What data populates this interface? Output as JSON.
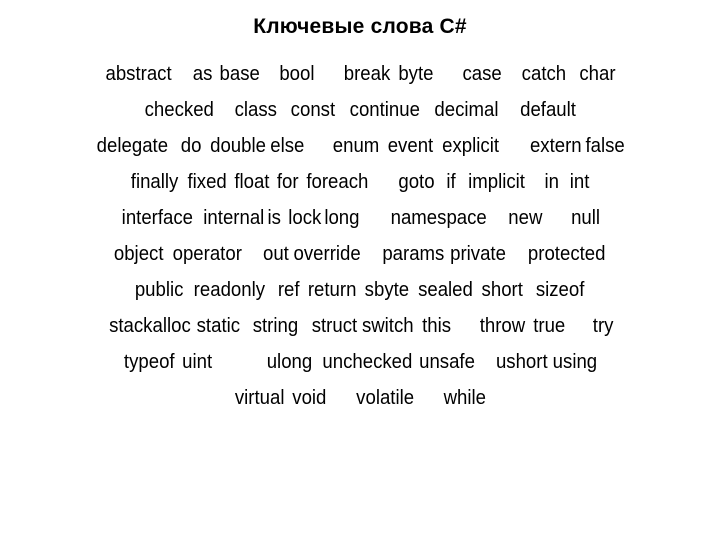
{
  "slide": {
    "title": "Ключевые слова C#",
    "background_color": "#ffffff",
    "text_color": "#000000",
    "keyword_lines": [
      {
        "line_number": 1,
        "text": "abstract   as base   bool    break byte    case   catch  char",
        "keywords": [
          "abstract",
          "as",
          "base",
          "bool",
          "break",
          "byte",
          "case",
          "catch",
          "char"
        ]
      },
      {
        "line_number": 2,
        "text": "checked   class   const  continue   decimal    default",
        "keywords": [
          "checked",
          "class",
          "const",
          "continue",
          "decimal",
          "default"
        ]
      },
      {
        "line_number": 3,
        "text": "delegate  do double else    enum event explicit     extern false",
        "keywords": [
          "delegate",
          "do",
          "double",
          "else",
          "enum",
          "event",
          "explicit",
          "extern",
          "false"
        ]
      },
      {
        "line_number": 4,
        "text": "finally fixed float for foreach    goto   if   implicit    in   int",
        "keywords": [
          "finally",
          "fixed",
          "float",
          "for",
          "foreach",
          "goto",
          "if",
          "implicit",
          "in",
          "int"
        ]
      },
      {
        "line_number": 5,
        "text": "interface internal is lock long    namespace   new    null",
        "keywords": [
          "interface",
          "internal",
          "is",
          "lock",
          "long",
          "namespace",
          "new",
          "null"
        ]
      },
      {
        "line_number": 6,
        "text": "object operator   out override   params private   protected",
        "keywords": [
          "object",
          "operator",
          "out",
          "override",
          "params",
          "private",
          "protected"
        ]
      },
      {
        "line_number": 7,
        "text": "public readonly  ref return sbyte sealed short   sizeof",
        "keywords": [
          "public",
          "readonly",
          "ref",
          "return",
          "sbyte",
          "sealed",
          "short",
          "sizeof"
        ]
      },
      {
        "line_number": 8,
        "text": "stackalloc static  string  struct switch this     throw  true    try",
        "keywords": [
          "stackalloc",
          "static",
          "string",
          "struct",
          "switch",
          "this",
          "throw",
          "true",
          "try"
        ]
      },
      {
        "line_number": 9,
        "text": "typeof uint         ulong  unchecked unsafe   ushort using",
        "keywords": [
          "typeof",
          "uint",
          "ulong",
          "unchecked",
          "unsafe",
          "ushort",
          "using"
        ]
      },
      {
        "line_number": 10,
        "text": "virtual void    volatile     while",
        "keywords": [
          "virtual",
          "void",
          "volatile",
          "while"
        ]
      }
    ]
  }
}
